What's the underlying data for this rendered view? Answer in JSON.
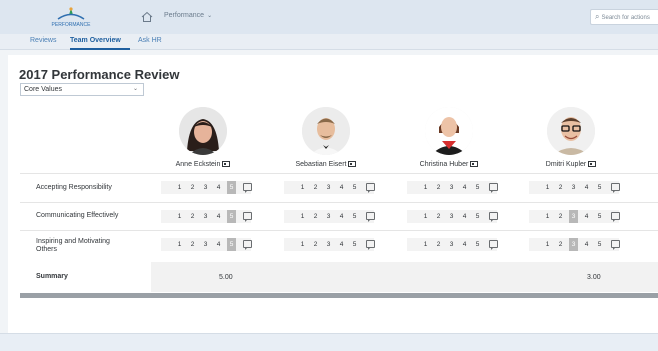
{
  "shell": {
    "logo_text": "PERFORMANCE",
    "app_title": "Performance",
    "search_placeholder": "Search for actions"
  },
  "tabs": [
    {
      "label": "Reviews"
    },
    {
      "label": "Team Overview"
    },
    {
      "label": "Ask HR"
    }
  ],
  "active_tab": "Team Overview",
  "main": {
    "title": "2017 Performance Review",
    "filter_selected": "Core Values"
  },
  "employees": [
    {
      "name": "Anne Eckstein"
    },
    {
      "name": "Sebastian Eisert"
    },
    {
      "name": "Christina Huber"
    },
    {
      "name": "Dmitri Kupler"
    }
  ],
  "scale": [
    "1",
    "2",
    "3",
    "4",
    "5"
  ],
  "criteria": [
    {
      "label": "Accepting Responsibility",
      "ratings": [
        5,
        null,
        null,
        null
      ]
    },
    {
      "label": "Communicating Effectively",
      "ratings": [
        5,
        null,
        null,
        3
      ]
    },
    {
      "label": "Inspiring and Motivating Others",
      "ratings": [
        5,
        null,
        null,
        3
      ]
    }
  ],
  "summary": {
    "label": "Summary",
    "values": [
      "5.00",
      "",
      "",
      "3.00"
    ]
  },
  "colors": {
    "shell_bg": "#dde6f0",
    "accent": "#1f5f9f",
    "selected_rating": "#b8b8b8"
  }
}
